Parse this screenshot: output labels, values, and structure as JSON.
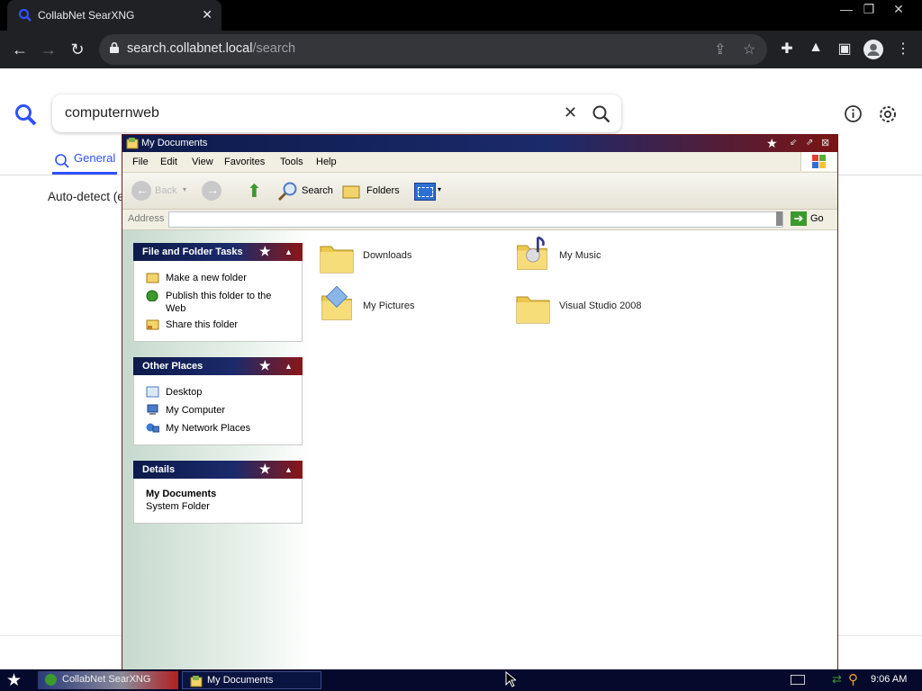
{
  "browser": {
    "tab_title": "CollabNet SearXNG",
    "url_host": "search.collabnet.local",
    "url_path": "/search"
  },
  "search": {
    "query": "computernweb",
    "tab_general": "General",
    "autodetect_text": "Auto-detect (e"
  },
  "explorer": {
    "title": "My Documents",
    "menu": [
      "File",
      "Edit",
      "View",
      "Favorites",
      "Tools",
      "Help"
    ],
    "toolbar": {
      "search": "Search",
      "folders": "Folders",
      "back": "Back"
    },
    "address_label": "Address",
    "address_value": "",
    "go_label": "Go",
    "file_tasks": {
      "title": "File and Folder Tasks",
      "items": [
        "Make a new folder",
        "Publish this folder to the Web",
        "Share this folder"
      ]
    },
    "other_places": {
      "title": "Other Places",
      "items": [
        "Desktop",
        "My Computer",
        "My Network Places"
      ]
    },
    "details": {
      "title": "Details",
      "name": "My Documents",
      "type": "System Folder"
    },
    "folders": [
      "Downloads",
      "My Music",
      "My Pictures",
      "Visual Studio 2008"
    ]
  },
  "taskbar": {
    "items": [
      "CollabNet SearXNG",
      "My Documents"
    ],
    "clock": "9:06 AM"
  },
  "colors": {
    "accent": "#3050ff",
    "title_navy": "#1b2a6b",
    "title_red": "#8a1616"
  }
}
